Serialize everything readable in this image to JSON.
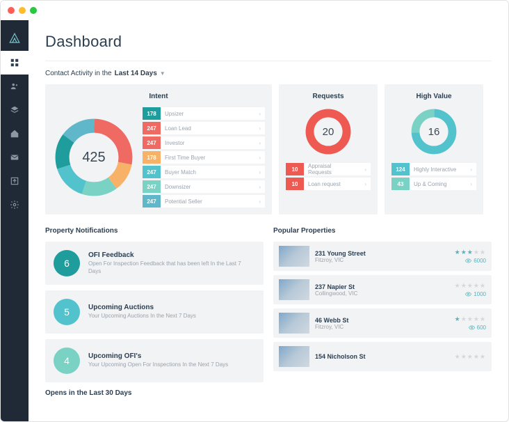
{
  "page": {
    "title": "Dashboard"
  },
  "filter": {
    "prefix": "Contact Activity in the",
    "period": "Last 14 Days"
  },
  "colors": {
    "teal": "#1f9c9c",
    "coral": "#ee6a63",
    "orange": "#f7b267",
    "cyan": "#52c2cc",
    "mint": "#79d2c4",
    "blueish": "#5fb7c9",
    "red": "#ee5a52"
  },
  "intent": {
    "title": "Intent",
    "total": "425",
    "items": [
      {
        "count": "178",
        "label": "Upsizer",
        "color": "#1f9c9c"
      },
      {
        "count": "247",
        "label": "Loan Lead",
        "color": "#ee6a63"
      },
      {
        "count": "247",
        "label": "Investor",
        "color": "#ee6a63"
      },
      {
        "count": "178",
        "label": "First Time Buyer",
        "color": "#f7b267"
      },
      {
        "count": "247",
        "label": "Buyer Match",
        "color": "#52c2cc"
      },
      {
        "count": "247",
        "label": "Downsizer",
        "color": "#79d2c4"
      },
      {
        "count": "247",
        "label": "Potential Seller",
        "color": "#5fb7c9"
      }
    ]
  },
  "requests": {
    "title": "Requests",
    "total": "20",
    "items": [
      {
        "count": "10",
        "label": "Appraisal Requests",
        "color": "#ee5a52"
      },
      {
        "count": "10",
        "label": "Loan request",
        "color": "#ee5a52"
      }
    ]
  },
  "highvalue": {
    "title": "High Value",
    "total": "16",
    "items": [
      {
        "count": "124",
        "label": "Highly Interactive",
        "color": "#52c2cc"
      },
      {
        "count": "43",
        "label": "Up & Coming",
        "color": "#79d2c4"
      }
    ]
  },
  "notifications": {
    "title": "Property Notifications",
    "items": [
      {
        "count": "6",
        "title": "OFI Feedback",
        "sub": "Open For Inspection Feedback that has been left In the Last 7 Days",
        "color": "#1f9c9c"
      },
      {
        "count": "5",
        "title": "Upcoming Auctions",
        "sub": "Your Upcoming Auctions In the Next 7 Days",
        "color": "#52c2cc"
      },
      {
        "count": "4",
        "title": "Upcoming OFI's",
        "sub": "Your Upcoming Open For Inspections In the Next 7 Days",
        "color": "#79d2c4"
      }
    ]
  },
  "popular": {
    "title": "Popular Properties",
    "items": [
      {
        "address": "231 Young Street",
        "location": "Fitzroy, VIC",
        "stars": 3,
        "views": "6000"
      },
      {
        "address": "237 Napier St",
        "location": "Collingwood, VIC",
        "stars": 0,
        "views": "1000"
      },
      {
        "address": "46 Webb St",
        "location": "Fitzroy, VIC",
        "stars": 1,
        "views": "600"
      },
      {
        "address": "154 Nicholson St",
        "location": "",
        "stars": 0,
        "views": ""
      }
    ]
  },
  "opens": {
    "title": "Opens in the Last 30 Days"
  },
  "chart_data": [
    {
      "type": "pie",
      "title": "Intent",
      "total": 425,
      "series": [
        {
          "name": "Upsizer",
          "value": 178,
          "color": "#1f9c9c"
        },
        {
          "name": "Loan Lead",
          "value": 247,
          "color": "#ee6a63"
        },
        {
          "name": "Investor",
          "value": 247,
          "color": "#ee6a63"
        },
        {
          "name": "First Time Buyer",
          "value": 178,
          "color": "#f7b267"
        },
        {
          "name": "Buyer Match",
          "value": 247,
          "color": "#52c2cc"
        },
        {
          "name": "Downsizer",
          "value": 247,
          "color": "#79d2c4"
        },
        {
          "name": "Potential Seller",
          "value": 247,
          "color": "#5fb7c9"
        }
      ]
    },
    {
      "type": "pie",
      "title": "Requests",
      "total": 20,
      "series": [
        {
          "name": "Appraisal Requests",
          "value": 10,
          "color": "#ee5a52"
        },
        {
          "name": "Loan request",
          "value": 10,
          "color": "#ee5a52"
        }
      ]
    },
    {
      "type": "pie",
      "title": "High Value",
      "total": 16,
      "series": [
        {
          "name": "Highly Interactive",
          "value": 124,
          "color": "#52c2cc"
        },
        {
          "name": "Up & Coming",
          "value": 43,
          "color": "#79d2c4"
        }
      ]
    }
  ]
}
